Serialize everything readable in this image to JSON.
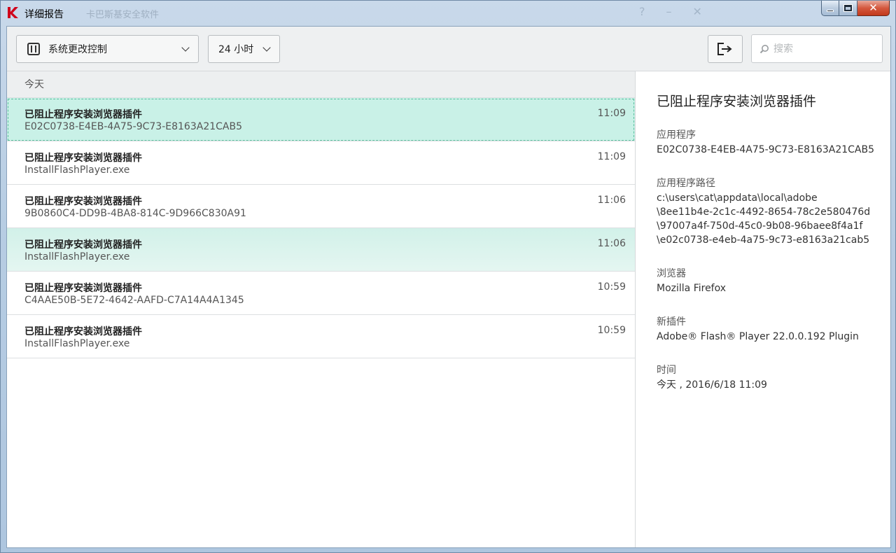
{
  "window": {
    "title": "详细报告",
    "background_title": "卡巴斯基安全软件",
    "brand_color": "#d0021b",
    "accent_selected": "#c9f1e7"
  },
  "toolbar": {
    "category_dropdown": "系统更改控制",
    "period_dropdown": "24 小时",
    "export_icon": "export-icon",
    "search_placeholder": "搜索"
  },
  "list": {
    "group_label": "今天",
    "rows": [
      {
        "title": "已阻止程序安装浏览器插件",
        "subtitle": "E02C0738-E4EB-4A75-9C73-E8163A21CAB5",
        "time": "11:09",
        "state": "selected"
      },
      {
        "title": "已阻止程序安装浏览器插件",
        "subtitle": "InstallFlashPlayer.exe",
        "time": "11:09",
        "state": "normal"
      },
      {
        "title": "已阻止程序安装浏览器插件",
        "subtitle": "9B0860C4-DD9B-4BA8-814C-9D966C830A91",
        "time": "11:06",
        "state": "normal"
      },
      {
        "title": "已阻止程序安装浏览器插件",
        "subtitle": "InstallFlashPlayer.exe",
        "time": "11:06",
        "state": "hover"
      },
      {
        "title": "已阻止程序安装浏览器插件",
        "subtitle": "C4AAE50B-5E72-4642-AAFD-C7A14A4A1345",
        "time": "10:59",
        "state": "normal"
      },
      {
        "title": "已阻止程序安装浏览器插件",
        "subtitle": "InstallFlashPlayer.exe",
        "time": "10:59",
        "state": "normal"
      }
    ]
  },
  "detail": {
    "title": "已阻止程序安装浏览器插件",
    "app_label": "应用程序",
    "app_value": "E02C0738-E4EB-4A75-9C73-E8163A21CAB5",
    "path_label": "应用程序路径",
    "path_lines": [
      "c:\\users\\cat\\appdata\\local\\adobe",
      "\\8ee11b4e-2c1c-4492-8654-78c2e580476d",
      "\\97007a4f-750d-45c0-9b08-96baee8f4a1f",
      "\\e02c0738-e4eb-4a75-9c73-e8163a21cab5"
    ],
    "browser_label": "浏览器",
    "browser_value": "Mozilla Firefox",
    "plugin_label": "新插件",
    "plugin_value": "Adobe® Flash® Player 22.0.0.192 Plugin",
    "time_label": "时间",
    "time_value": "今天 , 2016/6/18 11:09"
  }
}
